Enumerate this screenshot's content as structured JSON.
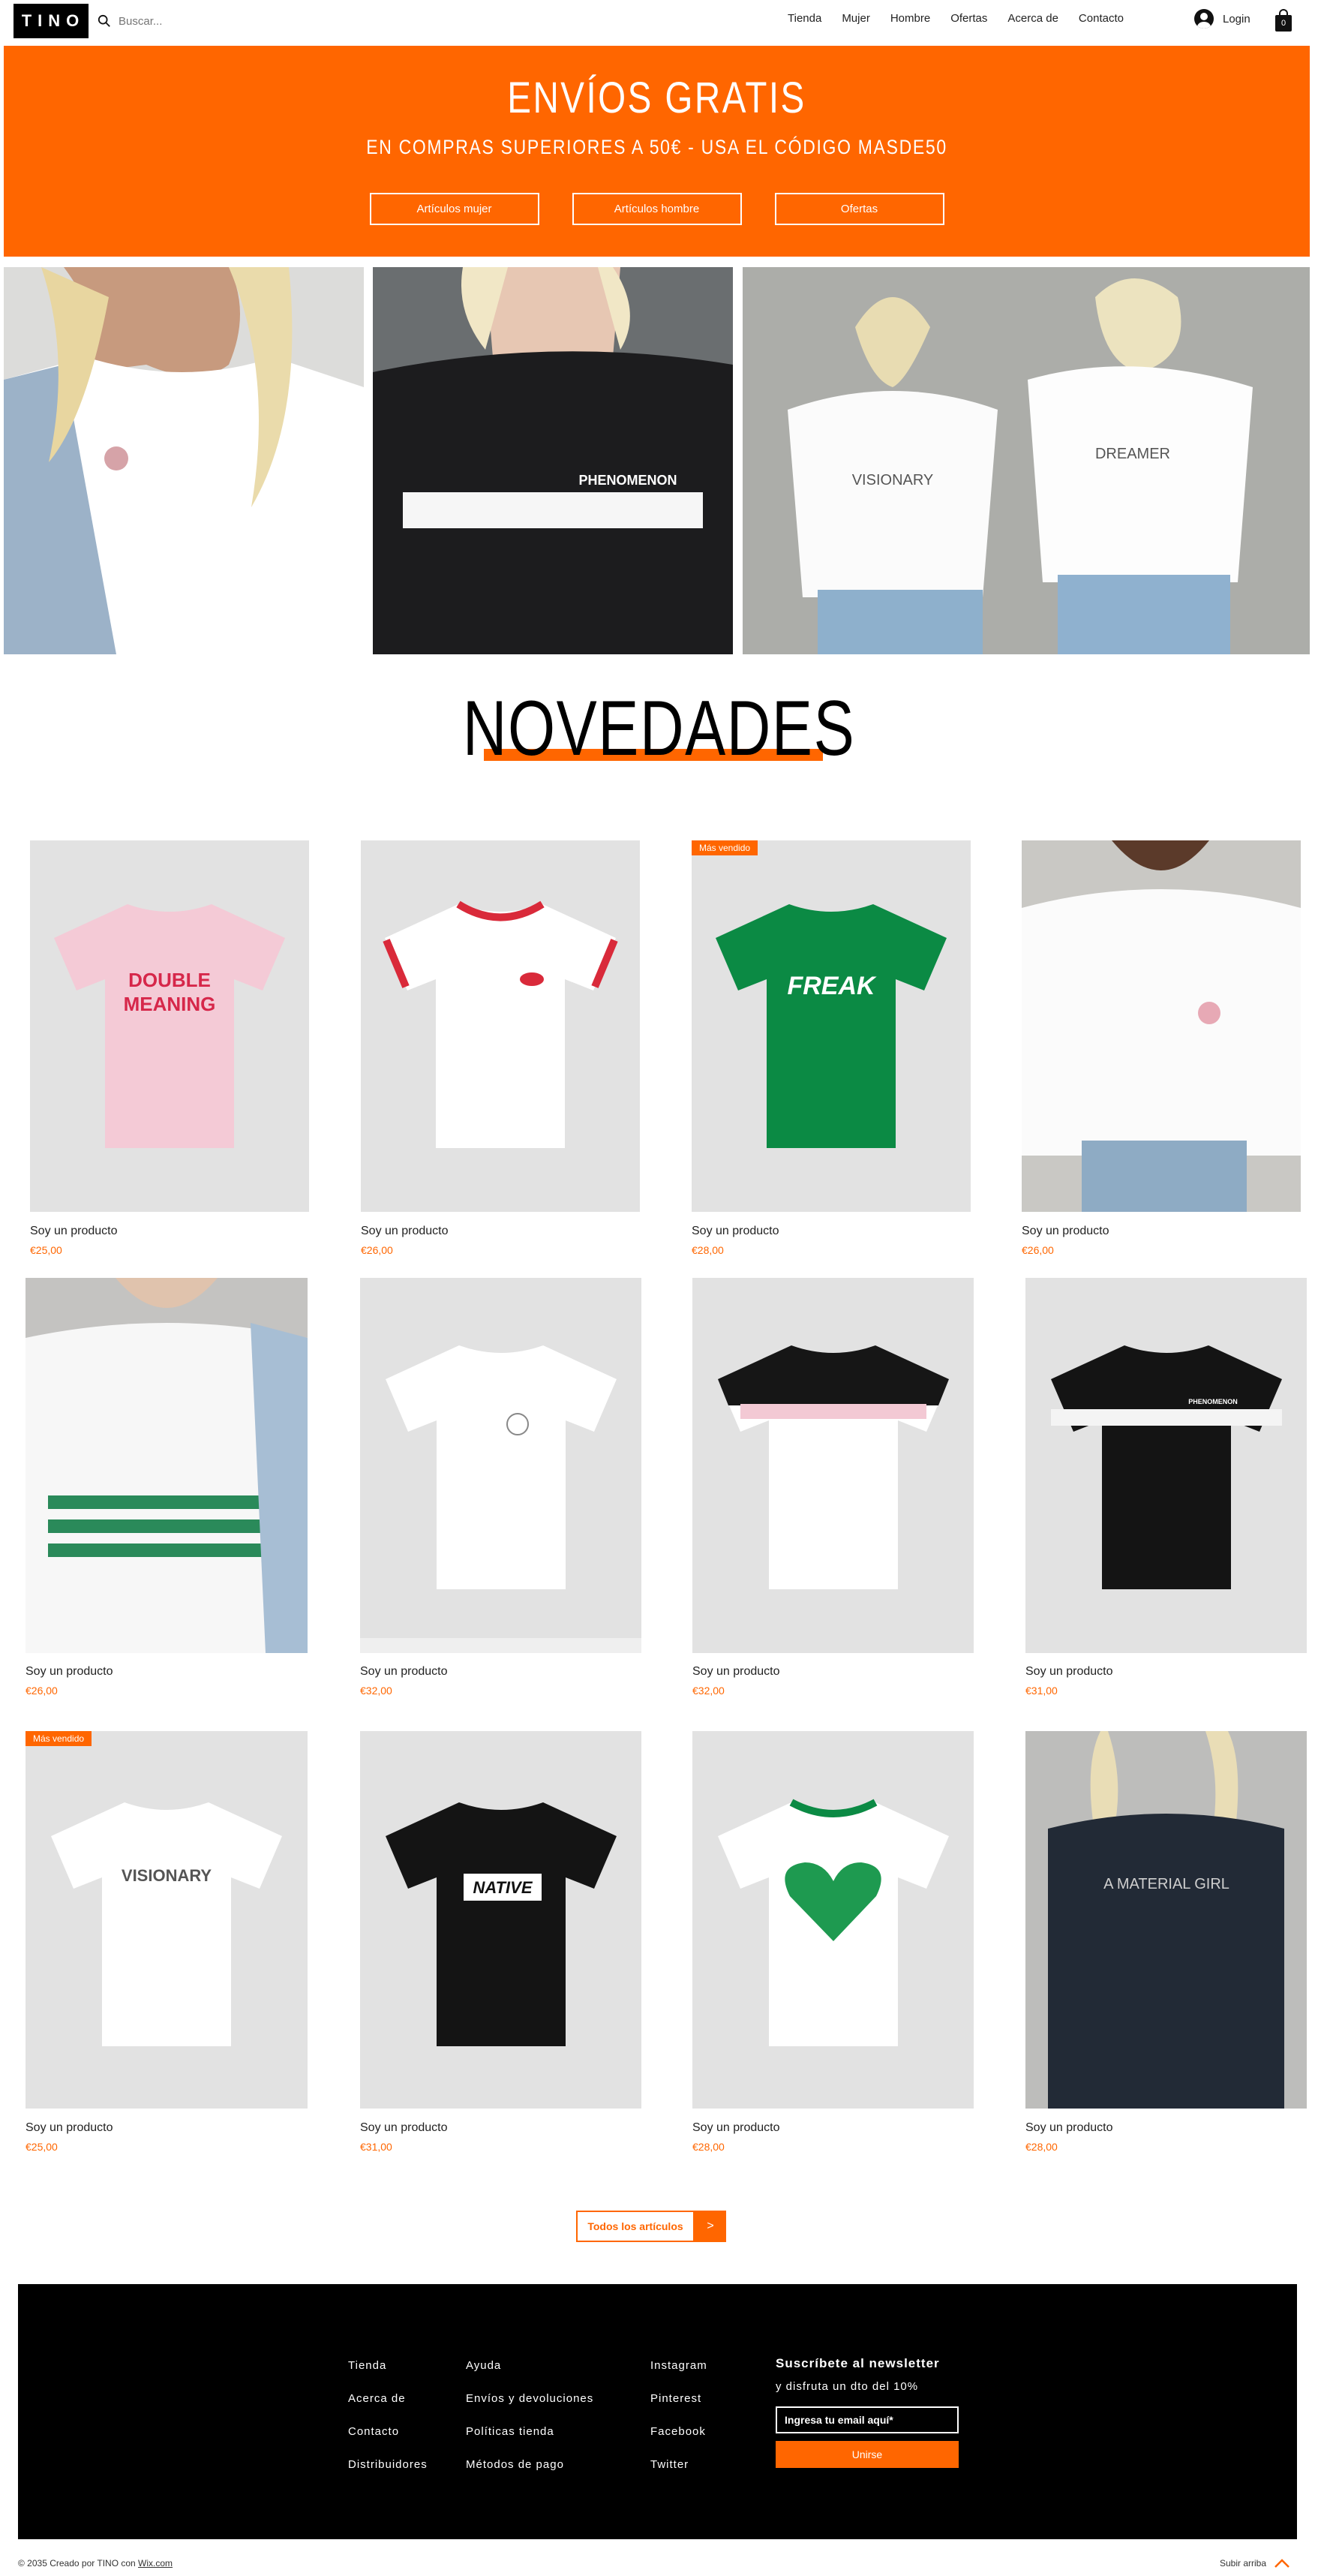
{
  "header": {
    "logo": "TINO",
    "search_placeholder": "Buscar...",
    "nav": [
      "Tienda",
      "Mujer",
      "Hombre",
      "Ofertas",
      "Acerca de",
      "Contacto"
    ],
    "login_label": "Login",
    "cart_count": "0"
  },
  "banner": {
    "title": "ENVÍOS GRATIS",
    "subtitle": "EN COMPRAS SUPERIORES A 50€ - USA EL CÓDIGO MASDE50",
    "buttons": [
      "Artículos mujer",
      "Artículos hombre",
      "Ofertas"
    ]
  },
  "hero": {
    "shirt_text_2": "PHENOMENON",
    "shirt_text_3a": "VISIONARY",
    "shirt_text_3b": "DREAMER"
  },
  "section_title": "NOVEDADES",
  "products": [
    {
      "name": "Soy un producto",
      "price": "€25,00",
      "badge": "",
      "print": "DOUBLE MEANING"
    },
    {
      "name": "Soy un producto",
      "price": "€26,00",
      "badge": "",
      "print": ""
    },
    {
      "name": "Soy un producto",
      "price": "€28,00",
      "badge": "Más vendido",
      "print": "FREAK"
    },
    {
      "name": "Soy un producto",
      "price": "€26,00",
      "badge": "",
      "print": ""
    },
    {
      "name": "Soy un producto",
      "price": "€26,00",
      "badge": "",
      "print": ""
    },
    {
      "name": "Soy un producto",
      "price": "€32,00",
      "badge": "",
      "print": ""
    },
    {
      "name": "Soy un producto",
      "price": "€32,00",
      "badge": "",
      "print": ""
    },
    {
      "name": "Soy un producto",
      "price": "€31,00",
      "badge": "",
      "print": "PHENOMENON"
    },
    {
      "name": "Soy un producto",
      "price": "€25,00",
      "badge": "Más vendido",
      "print": "VISIONARY"
    },
    {
      "name": "Soy un producto",
      "price": "€31,00",
      "badge": "",
      "print": "NATIVE"
    },
    {
      "name": "Soy un producto",
      "price": "€28,00",
      "badge": "",
      "print": ""
    },
    {
      "name": "Soy un producto",
      "price": "€28,00",
      "badge": "",
      "print": "A MATERIAL GIRL"
    }
  ],
  "all_button": {
    "label": "Todos los artículos",
    "arrow": ">"
  },
  "footer": {
    "col1": [
      "Tienda",
      "Acerca de",
      "Contacto",
      "Distribuidores"
    ],
    "col2": [
      "Ayuda",
      "Envíos y devoluciones",
      "Políticas tienda",
      "Métodos de pago"
    ],
    "col3": [
      "Instagram",
      "Pinterest",
      "Facebook",
      "Twitter"
    ],
    "newsletter_title": "Suscríbete al newsletter",
    "newsletter_sub": "y disfruta un dto del 10%",
    "email_placeholder": "Ingresa tu email aquí*",
    "subscribe_label": "Unirse"
  },
  "bottom": {
    "copyright": "© 2035 Creado por TINO con ",
    "wix_link": "Wix.com",
    "back_to_top": "Subir arriba"
  },
  "colors": {
    "accent": "#ff6600",
    "black": "#000000",
    "white": "#ffffff",
    "card_bg": "#e2e2e2"
  }
}
